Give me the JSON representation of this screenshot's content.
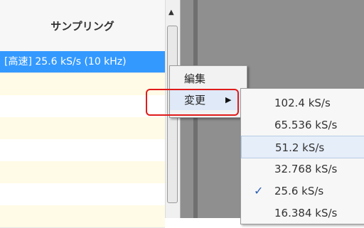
{
  "table": {
    "header": "サンプリング",
    "selected_row": "[高速] 25.6 kS/s (10 kHz)"
  },
  "context_menu": {
    "edit": "編集",
    "change": "変更"
  },
  "submenu": {
    "items": [
      "102.4 kS/s",
      "65.536 kS/s",
      "51.2 kS/s",
      "32.768 kS/s",
      "25.6 kS/s",
      "16.384 kS/s"
    ],
    "hovered": "51.2 kS/s",
    "checked": "25.6 kS/s"
  },
  "colors": {
    "selection": "#3399ff",
    "alt_row": "#fffbe6",
    "highlight_border": "#e01b1b",
    "gray_panel": "#8f8f8f"
  }
}
